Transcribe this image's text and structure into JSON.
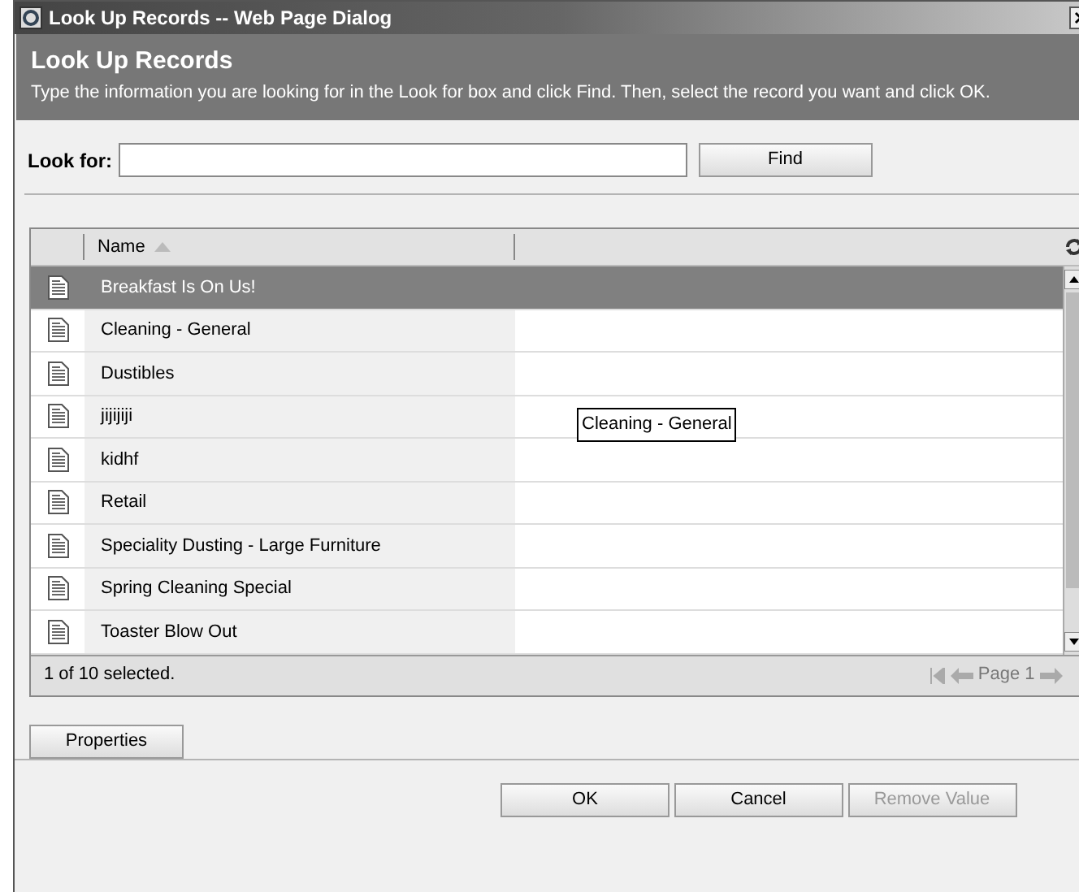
{
  "window": {
    "title": "Look Up Records -- Web Page Dialog"
  },
  "header": {
    "title": "Look Up Records",
    "instructions": "Type the information you are looking for in the Look for box and click Find. Then, select the record you want and click OK."
  },
  "search": {
    "label": "Look for:",
    "button": "Find"
  },
  "grid": {
    "columns": [
      "Name"
    ],
    "rows": [
      {
        "name": "Breakfast Is On Us!",
        "selected": true
      },
      {
        "name": "Cleaning - General",
        "selected": false
      },
      {
        "name": "Dustibles",
        "selected": false
      },
      {
        "name": "jijijiji",
        "selected": false
      },
      {
        "name": "kidhf",
        "selected": false
      },
      {
        "name": "Retail",
        "selected": false
      },
      {
        "name": "Speciality Dusting - Large Furniture",
        "selected": false
      },
      {
        "name": "Spring Cleaning Special",
        "selected": false
      },
      {
        "name": "Toaster Blow Out",
        "selected": false
      }
    ],
    "tooltip": "Cleaning - General",
    "status": "1 of 10 selected.",
    "page": "Page 1"
  },
  "properties_button": "Properties",
  "buttons": [
    {
      "label": "OK",
      "disabled": false
    },
    {
      "label": "Cancel",
      "disabled": false
    },
    {
      "label": "Remove Value",
      "disabled": true
    }
  ]
}
